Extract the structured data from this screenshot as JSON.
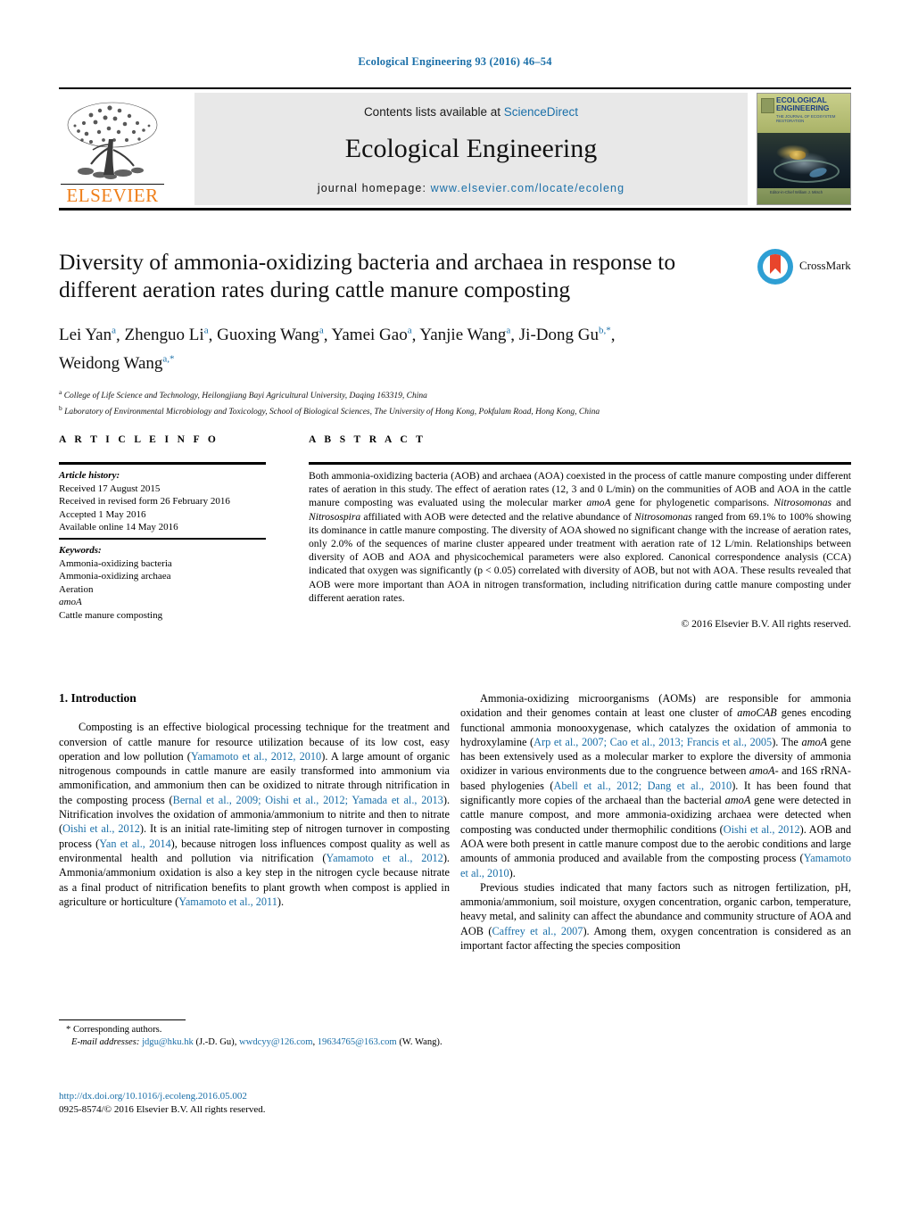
{
  "running_head": "Ecological Engineering 93 (2016) 46–54",
  "masthead": {
    "contents_lead": "Contents lists available at ",
    "sciencedirect": "ScienceDirect",
    "journal_title": "Ecological Engineering",
    "homepage_label": "journal homepage: ",
    "homepage_url": "www.elsevier.com/locate/ecoleng",
    "publisher_wordmark": "ELSEVIER",
    "cover": {
      "journal_name": "ECOLOGICAL ENGINEERING",
      "cover_subtitle": "THE JOURNAL OF ECOSYSTEM RESTORATION",
      "cover_footer": "Editor-in-Chief William J. Mitsch"
    }
  },
  "article": {
    "title": "Diversity of ammonia-oxidizing bacteria and archaea in response to different aeration rates during cattle manure composting",
    "authors_line1": "Lei Yan, Zhenguo Li, Guoxing Wang, Yamei Gao, Yanjie Wang, Ji-Dong Gu",
    "authors_line2": "Weidong Wang",
    "authors": [
      {
        "name": "Lei Yan",
        "sup": "a"
      },
      {
        "name": "Zhenguo Li",
        "sup": "a"
      },
      {
        "name": "Guoxing Wang",
        "sup": "a"
      },
      {
        "name": "Yamei Gao",
        "sup": "a"
      },
      {
        "name": "Yanjie Wang",
        "sup": "a"
      },
      {
        "name": "Ji-Dong Gu",
        "sup": "b,*"
      },
      {
        "name": "Weidong Wang",
        "sup": "a,*"
      }
    ],
    "affiliations": [
      {
        "mark": "a",
        "text": "College of Life Science and Technology, Heilongjiang Bayi Agricultural University, Daqing 163319, China"
      },
      {
        "mark": "b",
        "text": "Laboratory of Environmental Microbiology and Toxicology, School of Biological Sciences, The University of Hong Kong, Pokfulam Road, Hong Kong, China"
      }
    ],
    "crossmark_label": "CrossMark"
  },
  "article_info": {
    "heading": "A R T I C L E   I N F O",
    "history_label": "Article history:",
    "history": [
      "Received 17 August 2015",
      "Received in revised form 26 February 2016",
      "Accepted 1 May 2016",
      "Available online 14 May 2016"
    ],
    "keywords_label": "Keywords:",
    "keywords": [
      "Ammonia-oxidizing bacteria",
      "Ammonia-oxidizing archaea",
      "Aeration",
      "amoA",
      "Cattle manure composting"
    ]
  },
  "abstract": {
    "heading": "A B S T R A C T",
    "text_html": "Both ammonia-oxidizing bacteria (AOB) and archaea (AOA) coexisted in the process of cattle manure composting under different rates of aeration in this study. The effect of aeration rates (12, 3 and 0 L/min) on the communities of AOB and AOA in the cattle manure composting was evaluated using the molecular marker <i>amoA</i> gene for phylogenetic comparisons. <i>Nitrosomonas</i> and <i>Nitrosospira</i> affiliated with AOB were detected and the relative abundance of <i>Nitrosomonas</i> ranged from 69.1% to 100% showing its dominance in cattle manure composting. The diversity of AOA showed no significant change with the increase of aeration rates, only 2.0% of the sequences of marine cluster appeared under treatment with aeration rate of 12 L/min. Relationships between diversity of AOB and AOA and physicochemical parameters were also explored. Canonical correspondence analysis (CCA) indicated that oxygen was significantly (p &lt; 0.05) correlated with diversity of AOB, but not with AOA. These results revealed that AOB were more important than AOA in nitrogen transformation, including nitrification during cattle manure composting under different aeration rates.",
    "copyright": "© 2016 Elsevier B.V. All rights reserved."
  },
  "body": {
    "section_heading": "1. Introduction",
    "left_paragraphs_html": [
      "Composting is an effective biological processing technique for the treatment and conversion of cattle manure for resource utilization because of its low cost, easy operation and low pollution (<span class=\"cite\">Yamamoto et al., 2012, 2010</span>). A large amount of organic nitrogenous compounds in cattle manure are easily transformed into ammonium via ammonification, and ammonium then can be oxidized to nitrate through nitrification in the composting process (<span class=\"cite\">Bernal et al., 2009; Oishi et al., 2012; Yamada et al., 2013</span>). Nitrification involves the oxidation of ammonia/ammonium to nitrite and then to nitrate (<span class=\"cite\">Oishi et al., 2012</span>). It is an initial rate-limiting step of nitrogen turnover in composting process (<span class=\"cite\">Yan et al., 2014</span>), because nitrogen loss influences compost quality as well as environmental health and pollution via nitrification (<span class=\"cite\">Yamamoto et al., 2012</span>). Ammonia/ammonium oxidation is also a key step in the nitrogen cycle because nitrate as a final product of nitrification benefits to plant growth when compost is applied in agriculture or horticulture (<span class=\"cite\">Yamamoto et al., 2011</span>)."
    ],
    "right_paragraphs_html": [
      "Ammonia-oxidizing microorganisms (AOMs) are responsible for ammonia oxidation and their genomes contain at least one cluster of <i>amoCAB</i> genes encoding functional ammonia monooxygenase, which catalyzes the oxidation of ammonia to hydroxylamine (<span class=\"cite\">Arp et al., 2007; Cao et al., 2013; Francis et al., 2005</span>). The <i>amoA</i> gene has been extensively used as a molecular marker to explore the diversity of ammonia oxidizer in various environments due to the congruence between <i>amoA</i>- and 16S rRNA-based phylogenies (<span class=\"cite\">Abell et al., 2012; Dang et al., 2010</span>). It has been found that significantly more copies of the archaeal than the bacterial <i>amoA</i> gene were detected in cattle manure compost, and more ammonia-oxidizing archaea were detected when composting was conducted under thermophilic conditions (<span class=\"cite\">Oishi et al., 2012</span>). AOB and AOA were both present in cattle manure compost due to the aerobic conditions and large amounts of ammonia produced and available from the composting process (<span class=\"cite\">Yamamoto et al., 2010</span>).",
      "Previous studies indicated that many factors such as nitrogen fertilization, pH, ammonia/ammonium, soil moisture, oxygen concentration, organic carbon, temperature, heavy metal, and salinity can affect the abundance and community structure of AOA and AOB (<span class=\"cite\">Caffrey et al., 2007</span>). Among them, oxygen concentration is considered as an important factor affecting the species composition"
    ]
  },
  "footnote": {
    "corresponding": "* Corresponding authors.",
    "emails_label": "E-mail addresses:",
    "email1": "jdgu@hku.hk",
    "email1_owner": "(J.-D. Gu),",
    "email2": "wwdcyy@126.com",
    "email3": "19634765@163.com",
    "email3_owner": "(W. Wang)."
  },
  "doi": {
    "url": "http://dx.doi.org/10.1016/j.ecoleng.2016.05.002",
    "issn_line": "0925-8574/© 2016 Elsevier B.V. All rights reserved."
  },
  "colors": {
    "link_blue": "#1a6fa8",
    "elsevier_orange": "#ef7f1a",
    "crossmark_blue": "#2e9fd4",
    "crossmark_red": "#e8452c"
  }
}
